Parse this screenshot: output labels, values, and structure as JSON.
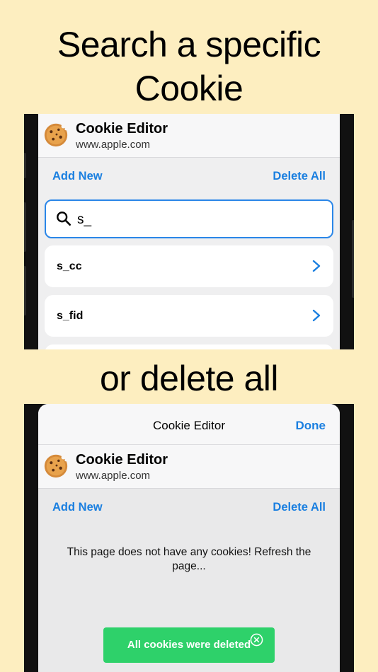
{
  "headline_top": "Search a specific Cookie",
  "headline_bottom": "or delete all",
  "colors": {
    "background": "#fdeec0",
    "accent": "#1a7fe0",
    "toast": "#2ed16a"
  },
  "screen1": {
    "app_title": "Cookie Editor",
    "app_url": "www.apple.com",
    "add_new_label": "Add New",
    "delete_all_label": "Delete All",
    "search": {
      "value": "s_",
      "icon": "search-icon"
    },
    "cookies": [
      {
        "name": "s_cc"
      },
      {
        "name": "s_fid"
      }
    ]
  },
  "screen2": {
    "nav_title": "Cookie Editor",
    "done_label": "Done",
    "app_title": "Cookie Editor",
    "app_url": "www.apple.com",
    "add_new_label": "Add New",
    "delete_all_label": "Delete All",
    "empty_message": "This page does not have any cookies! Refresh the page...",
    "toast_message": "All cookies were deleted"
  }
}
